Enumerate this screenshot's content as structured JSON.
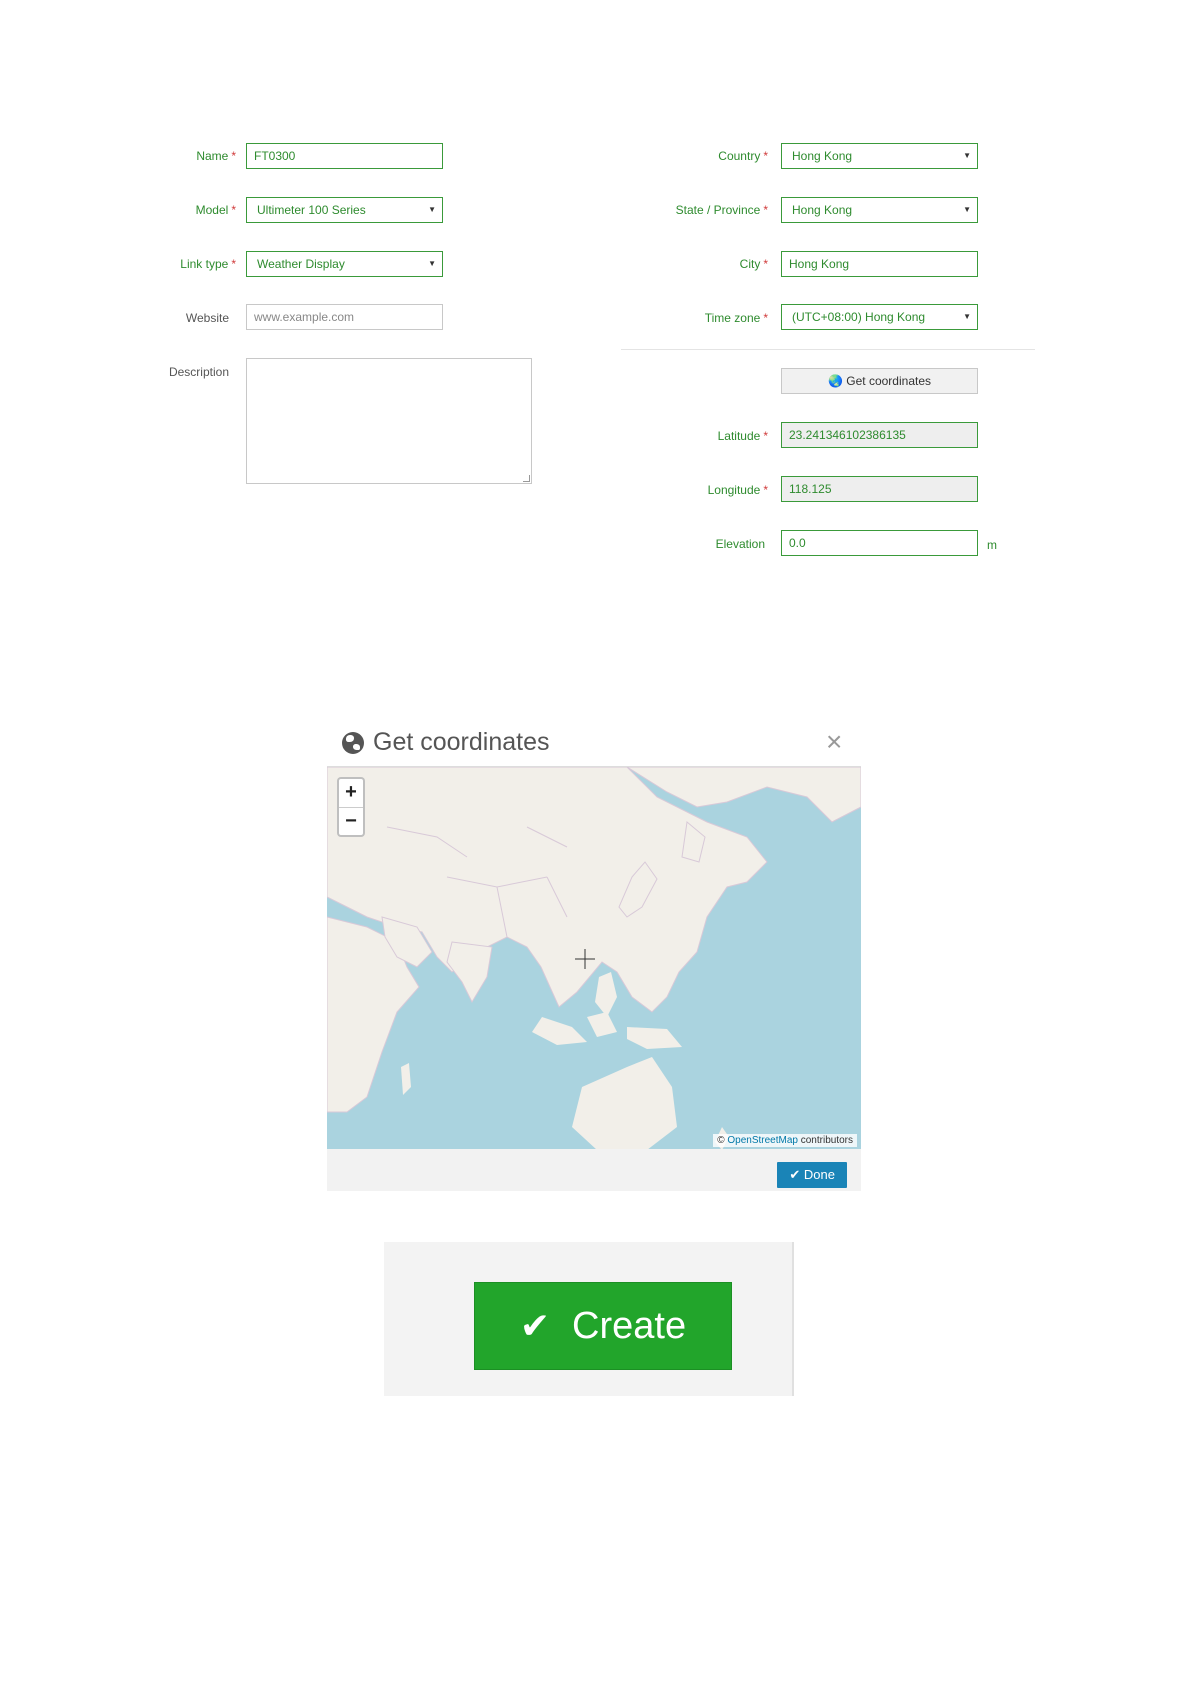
{
  "form": {
    "name": {
      "label": "Name",
      "value": "FT0300"
    },
    "model": {
      "label": "Model",
      "value": "Ultimeter 100 Series"
    },
    "link_type": {
      "label": "Link type",
      "value": "Weather Display"
    },
    "website": {
      "label": "Website",
      "placeholder": "www.example.com"
    },
    "description": {
      "label": "Description"
    },
    "country": {
      "label": "Country",
      "value": "Hong Kong"
    },
    "state": {
      "label": "State / Province",
      "value": "Hong Kong"
    },
    "city": {
      "label": "City",
      "value": "Hong Kong"
    },
    "timezone": {
      "label": "Time zone",
      "value": "(UTC+08:00) Hong Kong"
    },
    "get_coordinates_label": "Get coordinates",
    "latitude": {
      "label": "Latitude",
      "value": "23.241346102386135"
    },
    "longitude": {
      "label": "Longitude",
      "value": "118.125"
    },
    "elevation": {
      "label": "Elevation",
      "value": "0.0",
      "unit": "m"
    },
    "required_marker": "*"
  },
  "modal": {
    "title": "Get coordinates",
    "close": "×",
    "zoom_in": "+",
    "zoom_out": "−",
    "attribution_prefix": "©",
    "attribution_link": "OpenStreetMap",
    "attribution_suffix": "contributors",
    "done_label": "Done"
  },
  "actions": {
    "create_label": "Create"
  },
  "colors": {
    "accent_green": "#2e8b2e",
    "create_green": "#22a52b",
    "done_blue": "#1a84b7",
    "water": "#aad3df",
    "land": "#f2efe9"
  }
}
